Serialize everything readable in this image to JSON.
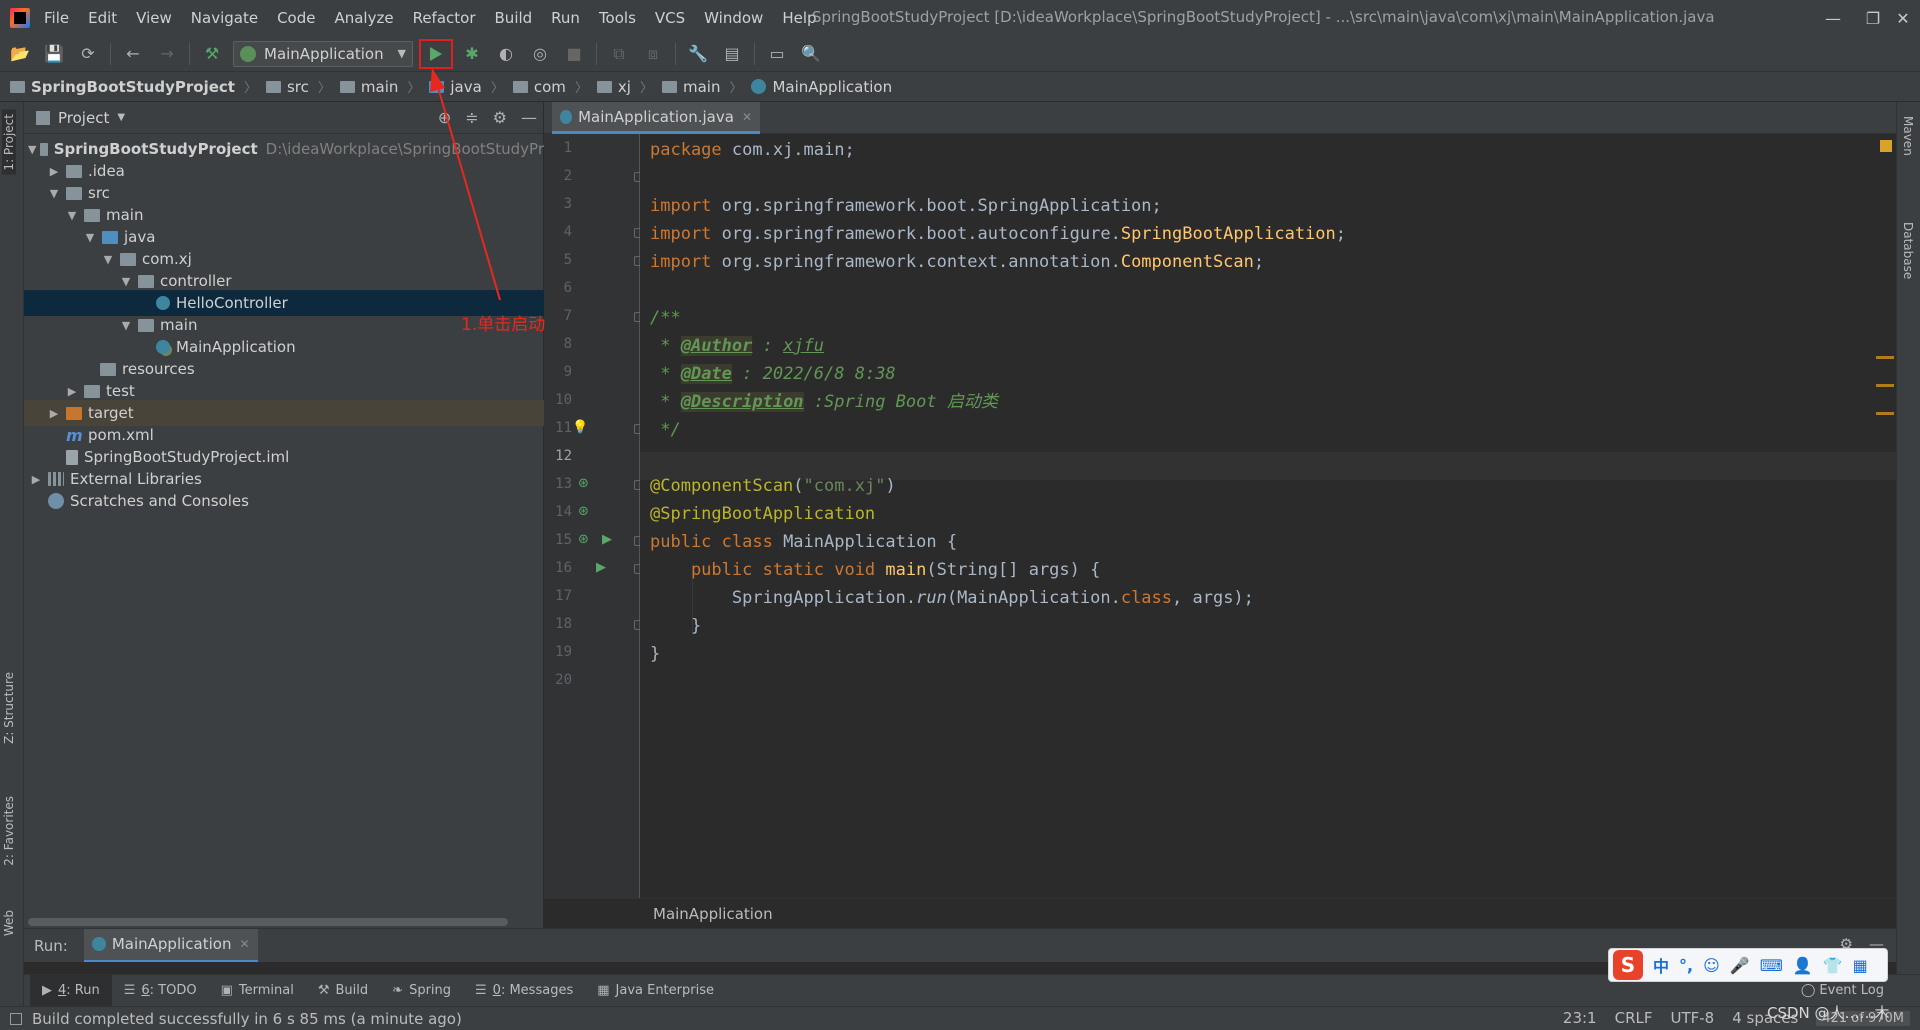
{
  "menubar": {
    "items": [
      "File",
      "Edit",
      "View",
      "Navigate",
      "Code",
      "Analyze",
      "Refactor",
      "Build",
      "Run",
      "Tools",
      "VCS",
      "Window",
      "Help"
    ],
    "window_title": "SpringBootStudyProject [D:\\ideaWorkplace\\SpringBootStudyProject] - ...\\src\\main\\java\\com\\xj\\main\\MainApplication.java",
    "minimize": "—",
    "maximize": "❐",
    "close": "✕"
  },
  "toolbar": {
    "run_config": "MainApplication"
  },
  "breadcrumb": [
    "SpringBootStudyProject",
    "src",
    "main",
    "java",
    "com",
    "xj",
    "main",
    "MainApplication"
  ],
  "left_stripe": {
    "project": "1: Project",
    "structure": "Z: Structure",
    "favorites": "2: Favorites",
    "web": "Web"
  },
  "right_stripe": {
    "maven": "Maven",
    "database": "Database"
  },
  "project_panel": {
    "title": "Project",
    "tree": [
      {
        "label": "SpringBootStudyProject",
        "path": "D:\\ideaWorkplace\\SpringBootStudyPr",
        "arrow": "▼"
      },
      {
        "label": ".idea",
        "arrow": "▶"
      },
      {
        "label": "src",
        "arrow": "▼"
      },
      {
        "label": "main",
        "arrow": "▼"
      },
      {
        "label": "java",
        "arrow": "▼"
      },
      {
        "label": "com.xj",
        "arrow": "▼"
      },
      {
        "label": "controller",
        "arrow": "▼"
      },
      {
        "label": "HelloController",
        "arrow": ""
      },
      {
        "label": "main",
        "arrow": "▼"
      },
      {
        "label": "MainApplication",
        "arrow": ""
      },
      {
        "label": "resources",
        "arrow": ""
      },
      {
        "label": "test",
        "arrow": "▶"
      },
      {
        "label": "target",
        "arrow": "▶"
      },
      {
        "label": "pom.xml",
        "arrow": ""
      },
      {
        "label": "SpringBootStudyProject.iml",
        "arrow": ""
      },
      {
        "label": "External Libraries",
        "arrow": "▶"
      },
      {
        "label": "Scratches and Consoles",
        "arrow": ""
      }
    ]
  },
  "editor": {
    "tab_label": "MainApplication.java",
    "line_numbers": [
      "1",
      "2",
      "3",
      "4",
      "5",
      "6",
      "7",
      "8",
      "9",
      "10",
      "11",
      "12",
      "13",
      "14",
      "15",
      "16",
      "17",
      "18",
      "19",
      "20"
    ],
    "active_line": "12",
    "code": {
      "l1_kw": "package",
      "l1_rest": " com.xj.main;",
      "l3_kw": "import",
      "l3_a": " org.springframework.boot.",
      "l3_b": "SpringApplication;",
      "l4_kw": "import",
      "l4_a": " org.springframework.boot.autoconfigure.",
      "l4_b": "SpringBootApplication",
      "l4_c": ";",
      "l5_kw": "import",
      "l5_a": " org.springframework.context.annotation.",
      "l5_b": "ComponentScan",
      "l5_c": ";",
      "l7": "/**",
      "l8_star": " * ",
      "l8_tag": "@Author",
      "l8_rest": " : ",
      "l8_val": "xjfu",
      "l9_star": " * ",
      "l9_tag": "@Date",
      "l9_rest": " : 2022/6/8 8:38",
      "l10_star": " * ",
      "l10_tag": "@Description",
      "l10_rest": " :Spring Boot 启动类",
      "l11": " */",
      "l13_ann": "@ComponentScan",
      "l13_p1": "(",
      "l13_str": "\"com.xj\"",
      "l13_p2": ")",
      "l14_ann": "@SpringBootApplication",
      "l15_kw": "public class",
      "l15_rest": " MainApplication {",
      "l16_kw": "    public static void",
      "l16_m": " main",
      "l16_rest": "(String[] args) {",
      "l17_a": "        SpringApplication.",
      "l17_run": "run",
      "l17_b": "(MainApplication.",
      "l17_kw": "class",
      "l17_c": ", args);",
      "l18": "    }",
      "l19": "}"
    },
    "footer": "MainApplication"
  },
  "annotation": {
    "label": "1.单击启动",
    "color": "#e8281f"
  },
  "run_panel": {
    "title": "Run:",
    "tab": "MainApplication"
  },
  "tool_windows": [
    {
      "key": "4",
      "label": ": Run",
      "icon": "▶"
    },
    {
      "key": "6",
      "label": ": TODO",
      "icon": "☰"
    },
    {
      "key": "",
      "label": "Terminal",
      "icon": "▣"
    },
    {
      "key": "",
      "label": "Build",
      "icon": "⚒"
    },
    {
      "key": "",
      "label": "Spring",
      "icon": "❧"
    },
    {
      "key": "0",
      "label": ": Messages",
      "icon": "☰"
    },
    {
      "key": "",
      "label": "Java Enterprise",
      "icon": "▦"
    }
  ],
  "event_log": "Event Log",
  "status": {
    "message": "Build completed successfully in 6 s 85 ms (a minute ago)",
    "position": "23:1",
    "line_sep": "CRLF",
    "encoding": "UTF-8",
    "indent": "4 spaces",
    "memory": "421 of 970M"
  },
  "ime": {
    "logo": "S",
    "items": [
      "中",
      "°,",
      "☺",
      "🎤",
      "⌨",
      "👤",
      "👕",
      "▦"
    ]
  },
  "watermark": "CSDN @人……木"
}
